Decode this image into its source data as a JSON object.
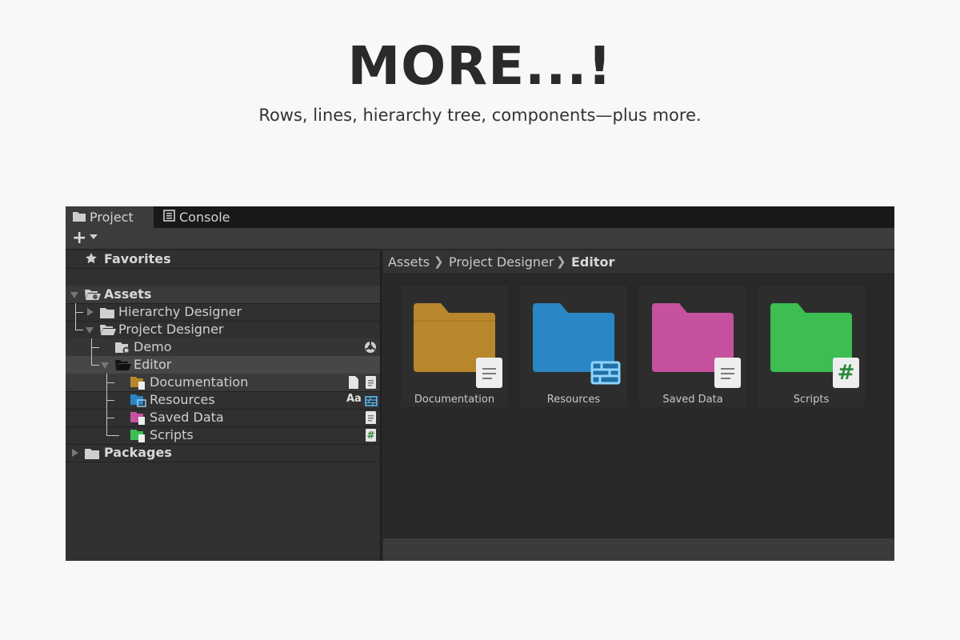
{
  "hero": {
    "title": "MORE...!",
    "subtitle": "Rows, lines, hierarchy tree, components—plus more."
  },
  "tabs": [
    {
      "label": "Project",
      "icon": "folder-icon",
      "active": true
    },
    {
      "label": "Console",
      "icon": "console-icon",
      "active": false
    }
  ],
  "toolbar": {
    "add_label": "+"
  },
  "tree": {
    "favorites": "Favorites",
    "assets": "Assets",
    "hierarchy_designer": "Hierarchy Designer",
    "project_designer": "Project Designer",
    "demo": "Demo",
    "editor": "Editor",
    "documentation": "Documentation",
    "resources": "Resources",
    "saved_data": "Saved Data",
    "scripts": "Scripts",
    "packages": "Packages",
    "resources_font_badge": "Aa",
    "scripts_badge": "#"
  },
  "breadcrumb": [
    "Assets",
    "Project Designer",
    "Editor"
  ],
  "grid": [
    {
      "name": "Documentation",
      "color": "#b8862b",
      "badge": "text-file-icon"
    },
    {
      "name": "Resources",
      "color": "#2a86c4",
      "badge": "grid-icon"
    },
    {
      "name": "Saved Data",
      "color": "#c6519f",
      "badge": "text-file-icon"
    },
    {
      "name": "Scripts",
      "color": "#3cbe52",
      "badge": "#"
    }
  ],
  "colors": {
    "documentation": "#b8862b",
    "resources": "#2a86c4",
    "saved_data": "#c6519f",
    "scripts": "#3cbe52"
  }
}
